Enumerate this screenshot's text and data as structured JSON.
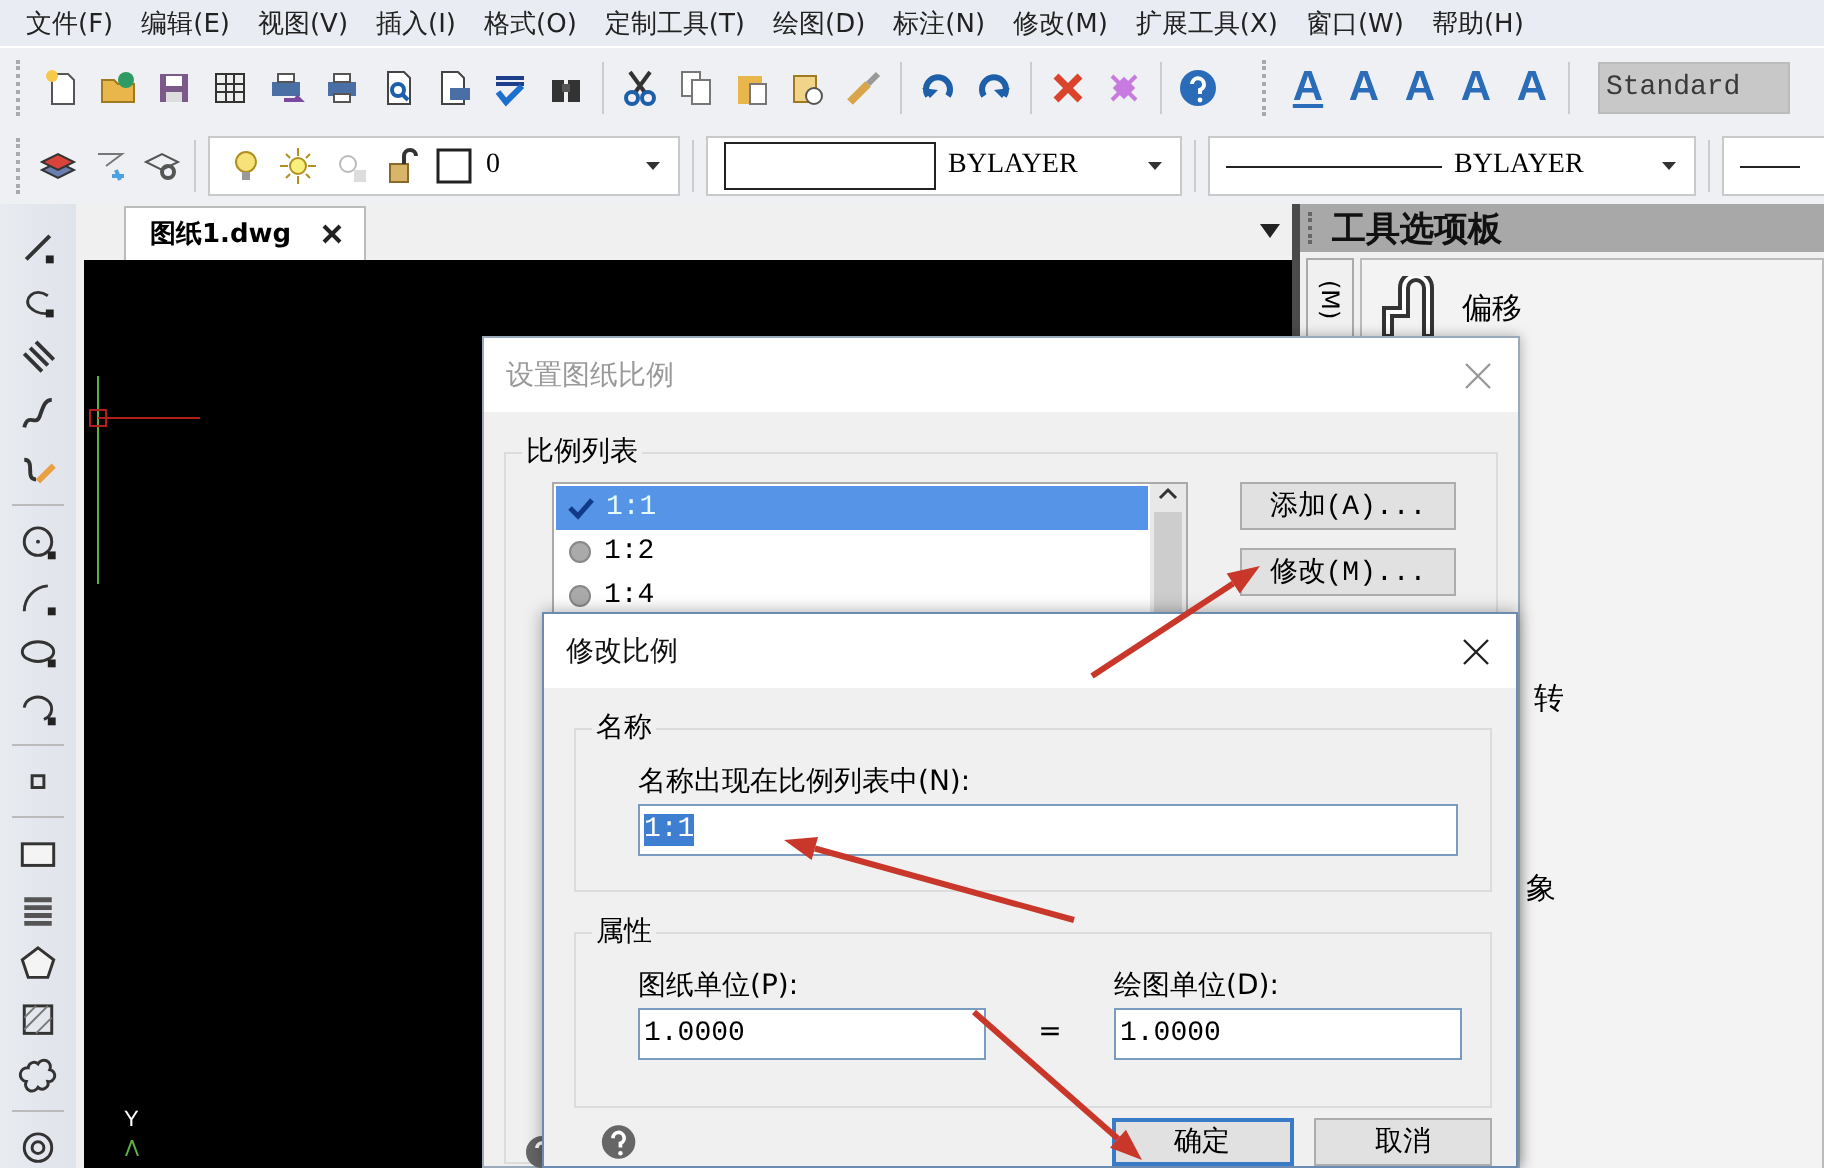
{
  "menu": [
    "文件(F)",
    "编辑(E)",
    "视图(V)",
    "插入(I)",
    "格式(O)",
    "定制工具(T)",
    "绘图(D)",
    "标注(N)",
    "修改(M)",
    "扩展工具(X)",
    "窗口(W)",
    "帮助(H)"
  ],
  "text_tool_glyphs": [
    "A",
    "A",
    "A",
    "A",
    "A"
  ],
  "style_field": {
    "value": "Standard",
    "disabled": true
  },
  "layer_combo": {
    "value": "0"
  },
  "color_combo": {
    "value": "BYLAYER"
  },
  "linetype_combo": {
    "value": "BYLAYER"
  },
  "tabs": [
    {
      "label": "图纸1.dwg",
      "selected": true
    }
  ],
  "canvas": {
    "axis_label": "Y"
  },
  "tool_palette": {
    "title": "工具选项板",
    "side_tab": "(M)",
    "items": [
      {
        "label": "偏移"
      },
      {
        "label": "转"
      },
      {
        "label": "象"
      }
    ]
  },
  "scale_dialog": {
    "title": "设置图纸比例",
    "active": false,
    "group": "比例列表",
    "scales": [
      {
        "label": "1:1",
        "selected": true
      },
      {
        "label": "1:2",
        "selected": false
      },
      {
        "label": "1:4",
        "selected": false
      }
    ],
    "buttons": [
      "添加(A)...",
      "修改(M)..."
    ]
  },
  "edit_dialog": {
    "title": "修改比例",
    "active": true,
    "name_group": "名称",
    "name_label": "名称出现在比例列表中(N):",
    "name_value": "1:1",
    "name_value_selected": true,
    "props_group": "属性",
    "paper_label": "图纸单位(P):",
    "paper_value": "1.0000",
    "equals": "=",
    "drawing_label": "绘图单位(D):",
    "drawing_value": "1.0000",
    "buttons": [
      {
        "label": "确定",
        "default": true
      },
      {
        "label": "取消",
        "default": false
      }
    ]
  }
}
